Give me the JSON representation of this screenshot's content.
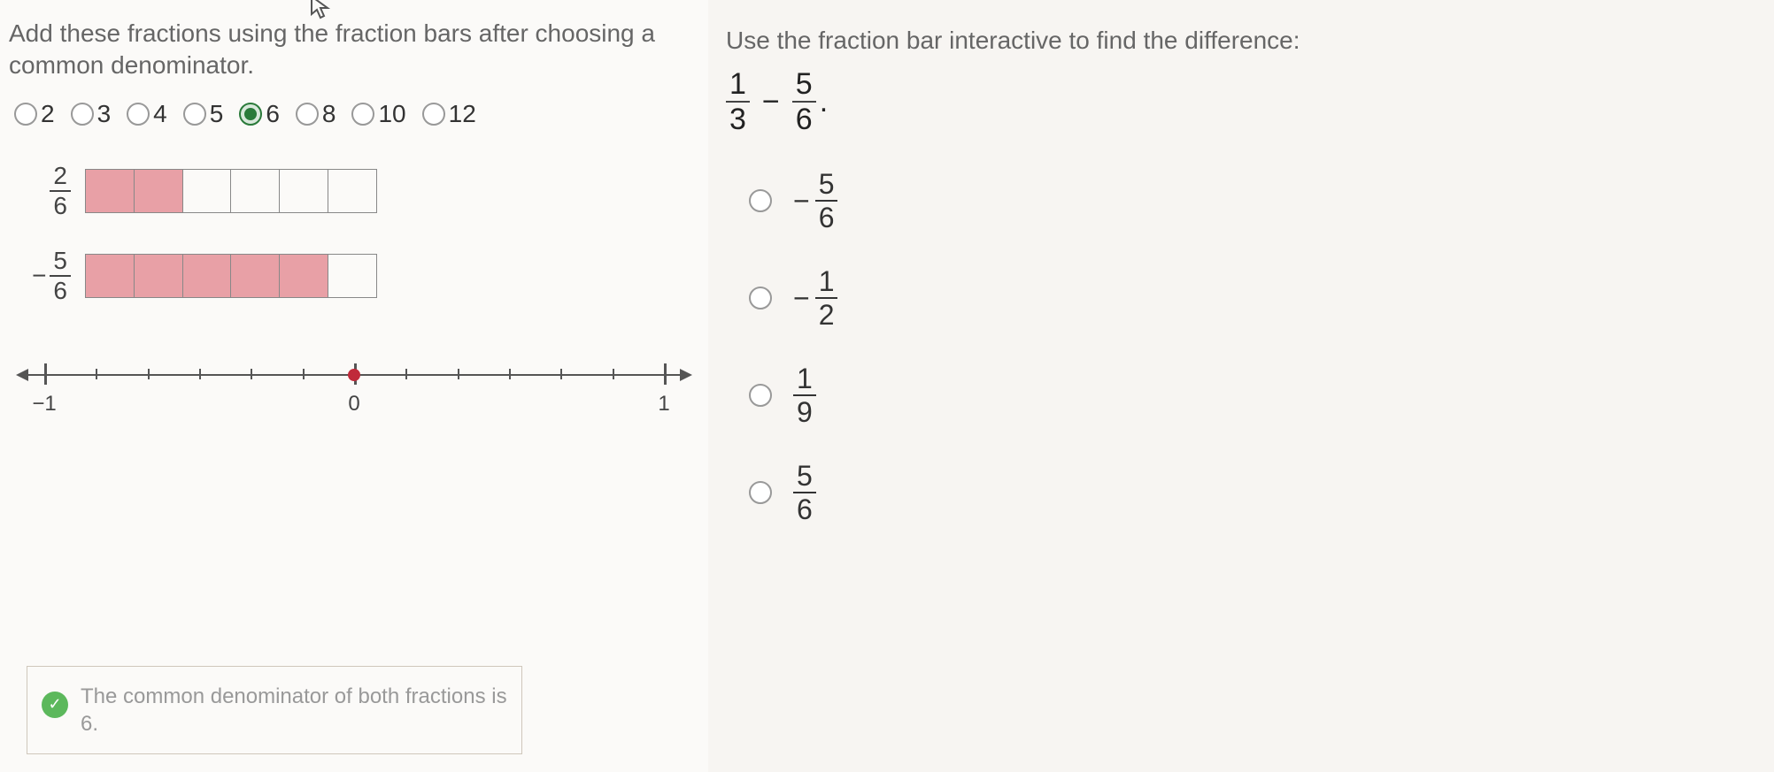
{
  "left": {
    "prompt": "Add these fractions using the fraction bars after choosing a common denominator.",
    "denominators": [
      {
        "label": "2",
        "selected": false
      },
      {
        "label": "3",
        "selected": false
      },
      {
        "label": "4",
        "selected": false
      },
      {
        "label": "5",
        "selected": false
      },
      {
        "label": "6",
        "selected": true
      },
      {
        "label": "8",
        "selected": false
      },
      {
        "label": "10",
        "selected": false
      },
      {
        "label": "12",
        "selected": false
      }
    ],
    "bars": [
      {
        "sign": "",
        "num": "2",
        "den": "6",
        "cells": 6,
        "filled": 2
      },
      {
        "sign": "−",
        "num": "5",
        "den": "6",
        "cells": 6,
        "filled": 5
      }
    ],
    "numline": {
      "min": -1,
      "max": 1,
      "step_divisions": 6,
      "labels": [
        {
          "value": -1,
          "text": "−1"
        },
        {
          "value": 0,
          "text": "0"
        },
        {
          "value": 1,
          "text": "1"
        }
      ],
      "dot_value": 0
    },
    "feedback": "The common denominator of both fractions is 6."
  },
  "right": {
    "prompt": "Use the fraction bar interactive to find the difference:",
    "expression": {
      "a_num": "1",
      "a_den": "3",
      "op": "−",
      "b_num": "5",
      "b_den": "6",
      "suffix": "."
    },
    "answers": [
      {
        "sign": "−",
        "num": "5",
        "den": "6"
      },
      {
        "sign": "−",
        "num": "1",
        "den": "2"
      },
      {
        "sign": "",
        "num": "1",
        "den": "9"
      },
      {
        "sign": "",
        "num": "5",
        "den": "6"
      }
    ]
  }
}
